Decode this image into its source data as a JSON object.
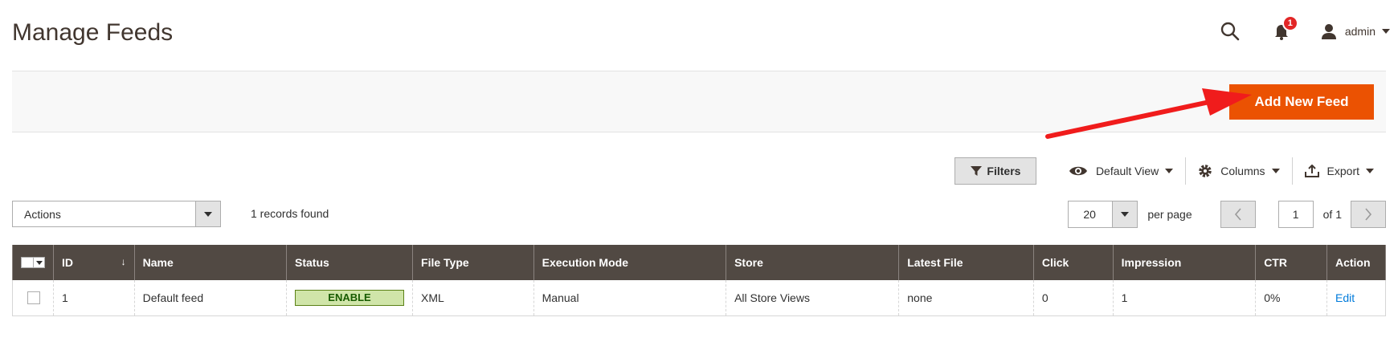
{
  "page": {
    "title": "Manage Feeds"
  },
  "header": {
    "notifications_count": "1",
    "user_name": "admin"
  },
  "toolbar": {
    "add_button_label": "Add New Feed"
  },
  "grid_toolbar": {
    "filters_label": "Filters",
    "view_label": "Default View",
    "columns_label": "Columns",
    "export_label": "Export"
  },
  "mass_actions": {
    "label": "Actions"
  },
  "records_found": "1 records found",
  "pager": {
    "per_page_value": "20",
    "per_page_label": "per page",
    "current_page": "1",
    "of_label": "of 1"
  },
  "table": {
    "columns": [
      "ID",
      "Name",
      "Status",
      "File Type",
      "Execution Mode",
      "Store",
      "Latest File",
      "Click",
      "Impression",
      "CTR",
      "Action"
    ],
    "rows": [
      {
        "id": "1",
        "name": "Default feed",
        "status": "ENABLE",
        "file_type": "XML",
        "execution_mode": "Manual",
        "store": "All Store Views",
        "latest_file": "none",
        "click": "0",
        "impression": "1",
        "ctr": "0%",
        "action": "Edit"
      }
    ]
  },
  "colors": {
    "accent": "#eb5202",
    "table_header": "#514943",
    "annotation_arrow": "#f01c1c",
    "status_enable_bg": "#d0e5a9",
    "link": "#007bdb"
  }
}
